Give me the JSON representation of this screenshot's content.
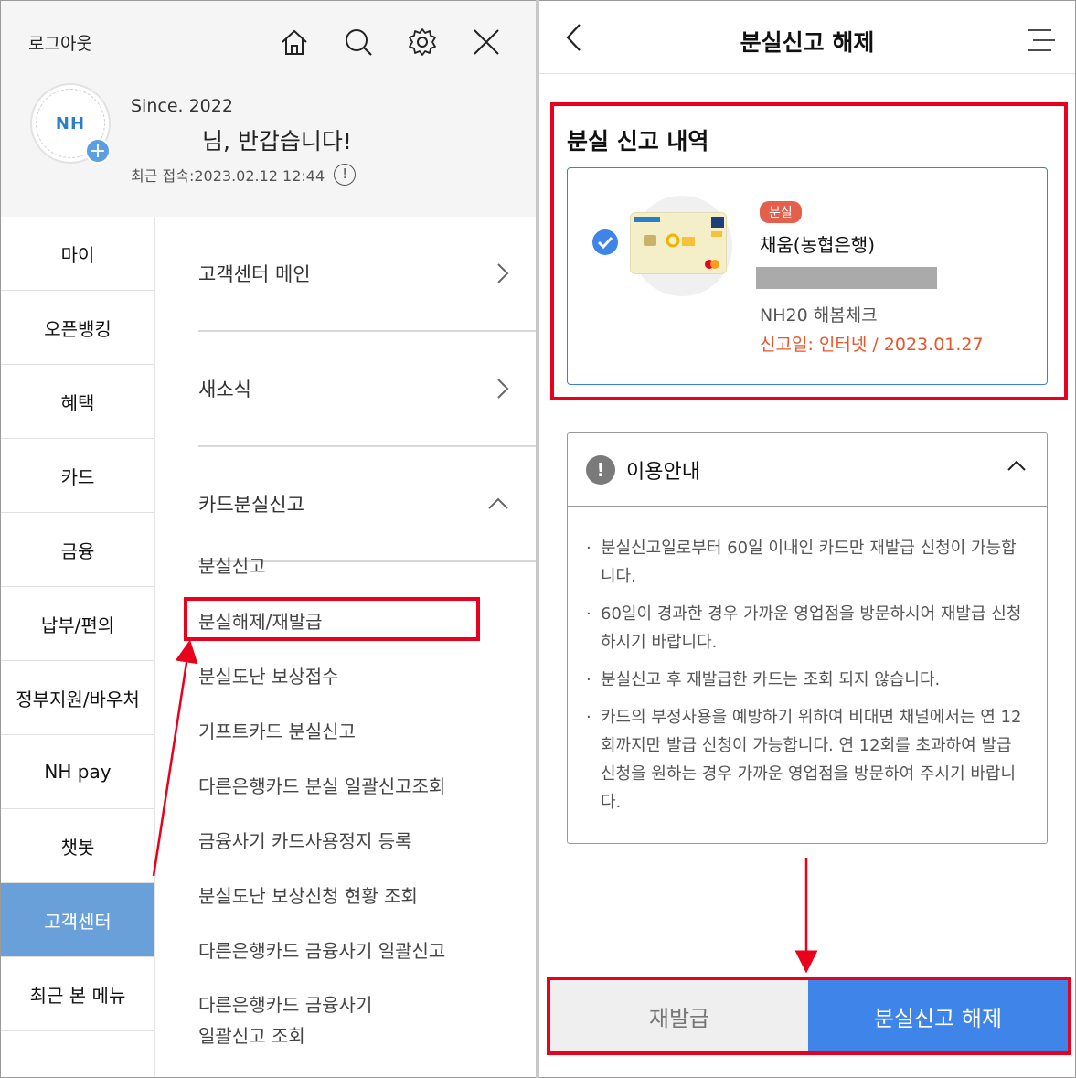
{
  "left": {
    "logout_label": "로그아웃",
    "since": "Since. 2022",
    "greeting": "님, 반갑습니다!",
    "last_login": "최근 접속:2023.02.12 12:44",
    "avatar_logo": "NH",
    "icons": [
      "home-icon",
      "search-icon",
      "gear-icon",
      "close-icon"
    ],
    "nav": [
      {
        "label": "마이"
      },
      {
        "label": "오픈뱅킹"
      },
      {
        "label": "혜택"
      },
      {
        "label": "카드"
      },
      {
        "label": "금융"
      },
      {
        "label": "납부/편의"
      },
      {
        "label": "정부지원/바우처"
      },
      {
        "label": "NH pay"
      },
      {
        "label": "챗봇"
      },
      {
        "label": "고객센터",
        "active": true
      },
      {
        "label": "최근 본 메뉴"
      }
    ],
    "sub_headers": [
      "고객센터 메인",
      "새소식",
      "카드분실신고"
    ],
    "sub_items": [
      "분실신고",
      "분실해제/재발급",
      "분실도난 보상접수",
      "기프트카드 분실신고",
      "다른은행카드 분실 일괄신고조회",
      "금융사기 카드사용정지 등록",
      "분실도난 보상신청 현황 조회",
      "다른은행카드 금융사기 일괄신고",
      "다른은행카드 금융사기",
      "일괄신고 조회"
    ]
  },
  "right": {
    "title": "분실신고  해제",
    "loss_section_title": "분실 신고 내역",
    "card": {
      "badge": "분실",
      "name": "채움(농협은행)",
      "product": "NH20 해봄체크",
      "report_date": "신고일:  인터넷 / 2023.01.27"
    },
    "guide": {
      "title": "이용안내",
      "items": [
        "분실신고일로부터 60일 이내인 카드만 재발급 신청이 가능합니다.",
        "60일이 경과한 경우 가까운 영업점을 방문하시어 재발급 신청하시기 바랍니다.",
        "분실신고 후 재발급한 카드는 조회 되지 않습니다.",
        "카드의 부정사용을 예방하기 위하여 비대면 채널에서는 연 12회까지만 발급 신청이 가능합니다. 연 12회를 초과하여 발급 신청을 원하는 경우 가까운 영업점을 방문하여 주시기 바랍니다."
      ]
    },
    "buttons": {
      "reissue": "재발급",
      "release": "분실신고 해제"
    }
  },
  "colors": {
    "highlight_red": "#e8001c",
    "primary_blue": "#3f84e9",
    "nav_active": "#6aa0d9",
    "date_orange": "#e9542a"
  }
}
